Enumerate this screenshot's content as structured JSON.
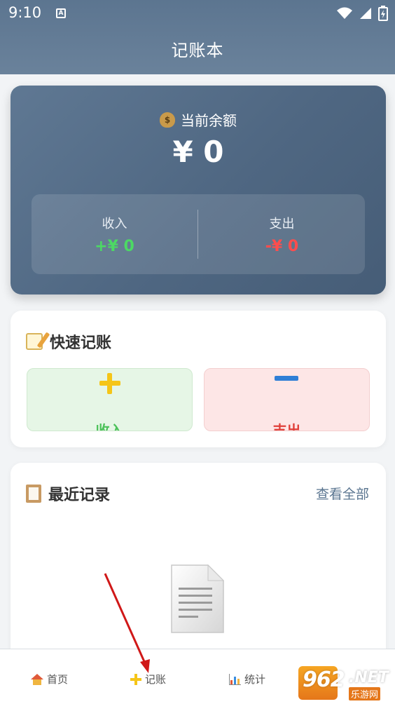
{
  "status_bar": {
    "time": "9:10",
    "notification_icon_letter": "A"
  },
  "header": {
    "title": "记账本"
  },
  "balance_card": {
    "label": "当前余额",
    "value": "¥ 0",
    "income_label": "收入",
    "income_value": "+¥ 0",
    "expense_label": "支出",
    "expense_value": "-¥ 0",
    "colors": {
      "income": "#4cd964",
      "expense": "#ff4d4d"
    }
  },
  "quick_entry": {
    "title": "快速记账",
    "income_button": "收入",
    "expense_button": "支出"
  },
  "recent": {
    "title": "最近记录",
    "view_all": "查看全部",
    "empty_icon": "document-icon"
  },
  "bottom_nav": {
    "items": [
      {
        "label": "首页",
        "icon": "home-icon"
      },
      {
        "label": "记账",
        "icon": "plus-icon"
      },
      {
        "label": "统计",
        "icon": "bar-chart-icon"
      }
    ]
  },
  "watermark": {
    "number": "962",
    "suffix": ".NET",
    "sub": "乐游网"
  }
}
